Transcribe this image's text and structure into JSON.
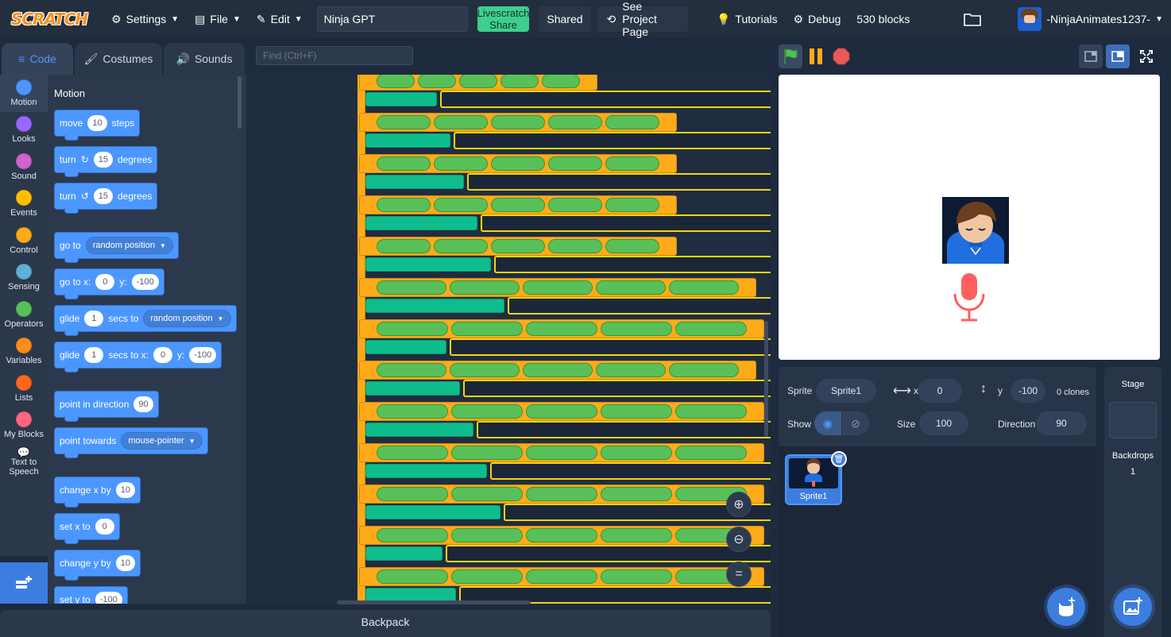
{
  "menubar": {
    "logo": "SCRATCH",
    "settings": "Settings",
    "file": "File",
    "edit": "Edit",
    "project_title": "Ninja GPT",
    "livescratch_line1": "Livescratch",
    "livescratch_line2": "Share",
    "shared": "Shared",
    "see_project_page": "See Project Page",
    "tutorials": "Tutorials",
    "debug": "Debug",
    "block_count": "530 blocks",
    "username": "-NinjaAnimates1237-"
  },
  "tabs": {
    "code": "Code",
    "costumes": "Costumes",
    "sounds": "Sounds"
  },
  "find": {
    "placeholder": "Find (Ctrl+F)"
  },
  "categories": [
    {
      "label": "Motion",
      "color": "#4c97ff"
    },
    {
      "label": "Looks",
      "color": "#9966ff"
    },
    {
      "label": "Sound",
      "color": "#cf63cf"
    },
    {
      "label": "Events",
      "color": "#ffbf00"
    },
    {
      "label": "Control",
      "color": "#ffab19"
    },
    {
      "label": "Sensing",
      "color": "#5cb1d6"
    },
    {
      "label": "Operators",
      "color": "#59c059"
    },
    {
      "label": "Variables",
      "color": "#ff8c1a"
    },
    {
      "label": "Lists",
      "color": "#ff661a"
    },
    {
      "label": "My Blocks",
      "color": "#ff6680"
    },
    {
      "label": "Text to Speech",
      "color": "#0fbd8c"
    }
  ],
  "palette": {
    "heading": "Motion",
    "move": {
      "a": "move",
      "v": "10",
      "b": "steps"
    },
    "turn_right": {
      "a": "turn",
      "v": "15",
      "b": "degrees"
    },
    "turn_left": {
      "a": "turn",
      "v": "15",
      "b": "degrees"
    },
    "goto": {
      "a": "go to",
      "opt": "random position"
    },
    "goto_xy": {
      "a": "go to x:",
      "x": "0",
      "b": "y:",
      "y": "-100"
    },
    "glide": {
      "a": "glide",
      "v": "1",
      "b": "secs to",
      "opt": "random position"
    },
    "glide_xy": {
      "a": "glide",
      "v": "1",
      "b": "secs to x:",
      "x": "0",
      "c": "y:",
      "y": "-100"
    },
    "point_dir": {
      "a": "point in direction",
      "v": "90"
    },
    "point_towards": {
      "a": "point towards",
      "opt": "mouse-pointer"
    },
    "change_x": {
      "a": "change x by",
      "v": "10"
    },
    "set_x": {
      "a": "set x to",
      "v": "0"
    },
    "change_y": {
      "a": "change y by",
      "v": "10"
    },
    "set_y": {
      "a": "set y to",
      "v": "-100"
    }
  },
  "backpack": "Backpack",
  "sprite": {
    "sprite_label": "Sprite",
    "name": "Sprite1",
    "x_label": "x",
    "x": "0",
    "y_label": "y",
    "y": "-100",
    "clones": "0 clones",
    "show_label": "Show",
    "size_label": "Size",
    "size": "100",
    "direction_label": "Direction",
    "direction": "90",
    "thumb_name": "Sprite1"
  },
  "stage_panel": {
    "title": "Stage",
    "backdrops_label": "Backdrops",
    "backdrops_count": "1"
  },
  "colors": {
    "accent": "#4c97ff",
    "flag": "#4cbf56",
    "pause": "#ffab19",
    "stop": "#ec5959"
  }
}
